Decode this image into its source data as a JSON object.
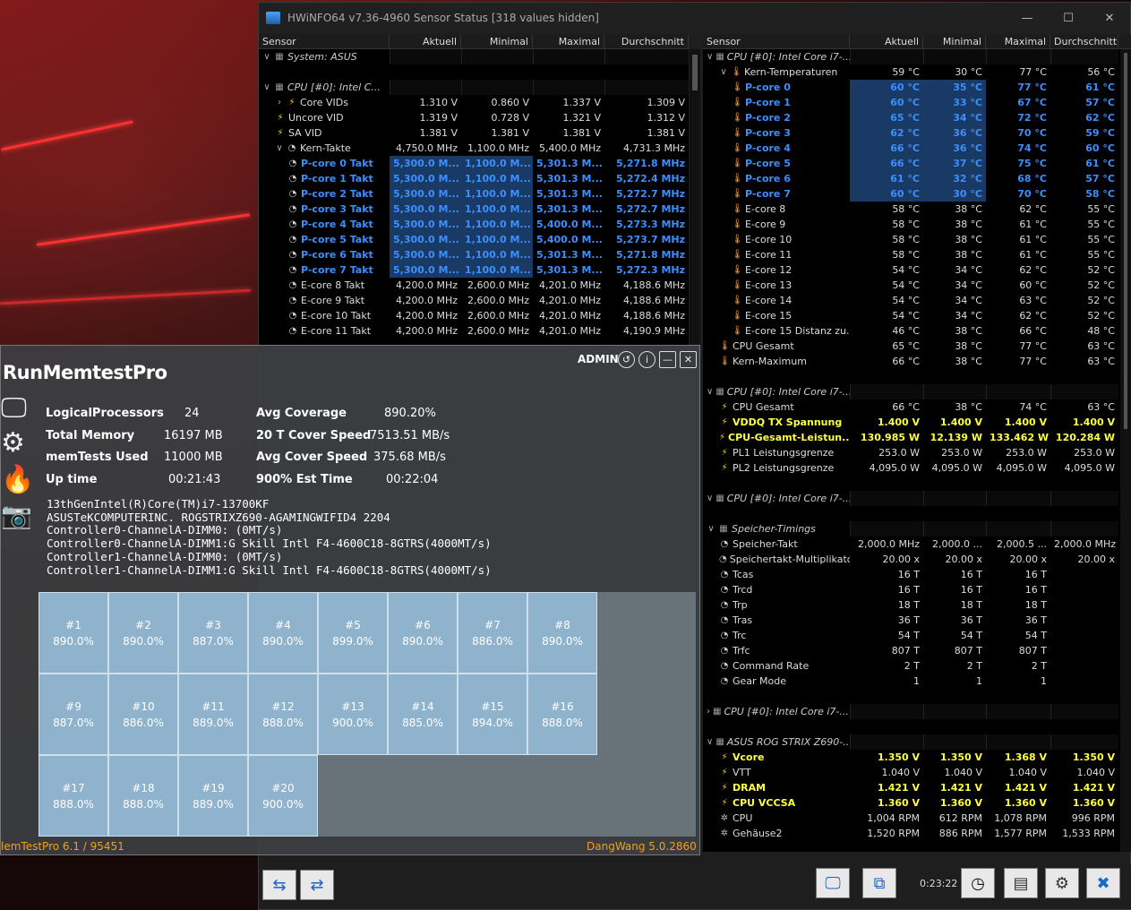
{
  "hwinfo": {
    "title": "HWiNFO64 v7.36-4960 Sensor Status [318 values hidden]",
    "win_controls": {
      "minimize": "—",
      "maximize": "☐",
      "close": "✕"
    },
    "columns": [
      "Sensor",
      "Aktuell",
      "Minimal",
      "Maximal",
      "Durchschnitt"
    ],
    "left_rows": [
      {
        "type": "group",
        "exp": "∨",
        "icon": "chip",
        "label": "System: ASUS",
        "v": [
          "",
          "",
          "",
          ""
        ]
      },
      {
        "type": "spacer"
      },
      {
        "type": "group",
        "exp": "∨",
        "icon": "chip",
        "label": "CPU [#0]: Intel C...",
        "v": [
          "",
          "",
          "",
          ""
        ]
      },
      {
        "type": "row",
        "exp": "›",
        "icon": "bolt",
        "label": "Core VIDs",
        "v": [
          "1.310 V",
          "0.860 V",
          "1.337 V",
          "1.309 V"
        ]
      },
      {
        "type": "row",
        "icon": "bolt",
        "label": "Uncore VID",
        "v": [
          "1.319 V",
          "0.728 V",
          "1.321 V",
          "1.312 V"
        ]
      },
      {
        "type": "row",
        "icon": "bolt",
        "label": "SA VID",
        "v": [
          "1.381 V",
          "1.381 V",
          "1.381 V",
          "1.381 V"
        ]
      },
      {
        "type": "row",
        "exp": "∨",
        "icon": "clock",
        "label": "Kern-Takte",
        "v": [
          "4,750.0 MHz",
          "1,100.0 MHz",
          "5,400.0 MHz",
          "4,731.3 MHz"
        ]
      },
      {
        "type": "blue",
        "icon": "clock",
        "label": "P-core 0 Takt",
        "v": [
          "5,300.0 M...",
          "1,100.0 M...",
          "5,301.3 M...",
          "5,271.8 MHz"
        ]
      },
      {
        "type": "blue",
        "icon": "clock",
        "label": "P-core 1 Takt",
        "v": [
          "5,300.0 M...",
          "1,100.0 M...",
          "5,301.3 M...",
          "5,272.4 MHz"
        ]
      },
      {
        "type": "blue",
        "icon": "clock",
        "label": "P-core 2 Takt",
        "v": [
          "5,300.0 M...",
          "1,100.0 M...",
          "5,301.3 M...",
          "5,272.7 MHz"
        ]
      },
      {
        "type": "blue",
        "icon": "clock",
        "label": "P-core 3 Takt",
        "v": [
          "5,300.0 M...",
          "1,100.0 M...",
          "5,301.3 M...",
          "5,272.7 MHz"
        ]
      },
      {
        "type": "blue",
        "icon": "clock",
        "label": "P-core 4 Takt",
        "v": [
          "5,300.0 M...",
          "1,100.0 M...",
          "5,400.0 M...",
          "5,273.3 MHz"
        ]
      },
      {
        "type": "blue",
        "icon": "clock",
        "label": "P-core 5 Takt",
        "v": [
          "5,300.0 M...",
          "1,100.0 M...",
          "5,400.0 M...",
          "5,273.7 MHz"
        ]
      },
      {
        "type": "blue",
        "icon": "clock",
        "label": "P-core 6 Takt",
        "v": [
          "5,300.0 M...",
          "1,100.0 M...",
          "5,301.3 M...",
          "5,271.8 MHz"
        ]
      },
      {
        "type": "blue",
        "icon": "clock",
        "label": "P-core 7 Takt",
        "v": [
          "5,300.0 M...",
          "1,100.0 M...",
          "5,301.3 M...",
          "5,272.3 MHz"
        ]
      },
      {
        "type": "row",
        "icon": "clock",
        "label": "E-core 8 Takt",
        "v": [
          "4,200.0 MHz",
          "2,600.0 MHz",
          "4,201.0 MHz",
          "4,188.6 MHz"
        ]
      },
      {
        "type": "row",
        "icon": "clock",
        "label": "E-core 9 Takt",
        "v": [
          "4,200.0 MHz",
          "2,600.0 MHz",
          "4,201.0 MHz",
          "4,188.6 MHz"
        ]
      },
      {
        "type": "row",
        "icon": "clock",
        "label": "E-core 10 Takt",
        "v": [
          "4,200.0 MHz",
          "2,600.0 MHz",
          "4,201.0 MHz",
          "4,188.6 MHz"
        ]
      },
      {
        "type": "row",
        "icon": "clock",
        "label": "E-core 11 Takt",
        "v": [
          "4,200.0 MHz",
          "2,600.0 MHz",
          "4,201.0 MHz",
          "4,190.9 MHz"
        ]
      }
    ],
    "right_rows": [
      {
        "type": "group",
        "exp": "∨",
        "icon": "chip",
        "label": "CPU [#0]: Intel Core i7-...",
        "v": [
          "",
          "",
          "",
          ""
        ]
      },
      {
        "type": "row",
        "exp": "∨",
        "icon": "therm",
        "label": "Kern-Temperaturen",
        "v": [
          "59 °C",
          "30 °C",
          "77 °C",
          "56 °C"
        ]
      },
      {
        "type": "blue",
        "icon": "therm",
        "label": "P-core 0",
        "v": [
          "60 °C",
          "35 °C",
          "77 °C",
          "61 °C"
        ]
      },
      {
        "type": "blue",
        "icon": "therm",
        "label": "P-core 1",
        "v": [
          "60 °C",
          "33 °C",
          "67 °C",
          "57 °C"
        ]
      },
      {
        "type": "blue",
        "icon": "therm",
        "label": "P-core 2",
        "v": [
          "65 °C",
          "34 °C",
          "72 °C",
          "62 °C"
        ]
      },
      {
        "type": "blue",
        "icon": "therm",
        "label": "P-core 3",
        "v": [
          "62 °C",
          "36 °C",
          "70 °C",
          "59 °C"
        ]
      },
      {
        "type": "blue",
        "icon": "therm",
        "label": "P-core 4",
        "v": [
          "66 °C",
          "36 °C",
          "74 °C",
          "60 °C"
        ]
      },
      {
        "type": "blue",
        "icon": "therm",
        "label": "P-core 5",
        "v": [
          "66 °C",
          "37 °C",
          "75 °C",
          "61 °C"
        ]
      },
      {
        "type": "blue",
        "icon": "therm",
        "label": "P-core 6",
        "v": [
          "61 °C",
          "32 °C",
          "68 °C",
          "57 °C"
        ]
      },
      {
        "type": "blue",
        "icon": "therm",
        "label": "P-core 7",
        "v": [
          "60 °C",
          "30 °C",
          "70 °C",
          "58 °C"
        ]
      },
      {
        "type": "row",
        "icon": "therm",
        "label": "E-core 8",
        "v": [
          "58 °C",
          "38 °C",
          "62 °C",
          "55 °C"
        ]
      },
      {
        "type": "row",
        "icon": "therm",
        "label": "E-core 9",
        "v": [
          "58 °C",
          "38 °C",
          "61 °C",
          "55 °C"
        ]
      },
      {
        "type": "row",
        "icon": "therm",
        "label": "E-core 10",
        "v": [
          "58 °C",
          "38 °C",
          "61 °C",
          "55 °C"
        ]
      },
      {
        "type": "row",
        "icon": "therm",
        "label": "E-core 11",
        "v": [
          "58 °C",
          "38 °C",
          "61 °C",
          "55 °C"
        ]
      },
      {
        "type": "row",
        "icon": "therm",
        "label": "E-core 12",
        "v": [
          "54 °C",
          "34 °C",
          "62 °C",
          "52 °C"
        ]
      },
      {
        "type": "row",
        "icon": "therm",
        "label": "E-core 13",
        "v": [
          "54 °C",
          "34 °C",
          "60 °C",
          "52 °C"
        ]
      },
      {
        "type": "row",
        "icon": "therm",
        "label": "E-core 14",
        "v": [
          "54 °C",
          "34 °C",
          "63 °C",
          "52 °C"
        ]
      },
      {
        "type": "row",
        "icon": "therm",
        "label": "E-core 15",
        "v": [
          "54 °C",
          "34 °C",
          "62 °C",
          "52 °C"
        ]
      },
      {
        "type": "row",
        "icon": "therm",
        "label": "E-core 15 Distanz zu...",
        "v": [
          "46 °C",
          "38 °C",
          "66 °C",
          "48 °C"
        ]
      },
      {
        "type": "row",
        "icon": "therm",
        "label": "CPU Gesamt",
        "v": [
          "65 °C",
          "38 °C",
          "77 °C",
          "63 °C"
        ]
      },
      {
        "type": "row",
        "icon": "therm",
        "label": "Kern-Maximum",
        "v": [
          "66 °C",
          "38 °C",
          "77 °C",
          "63 °C"
        ]
      },
      {
        "type": "spacer"
      },
      {
        "type": "group",
        "exp": "∨",
        "icon": "chip",
        "label": "CPU [#0]: Intel Core i7-...",
        "v": [
          "",
          "",
          "",
          ""
        ]
      },
      {
        "type": "row",
        "icon": "bolt",
        "label": "CPU Gesamt",
        "v": [
          "66 °C",
          "38 °C",
          "74 °C",
          "63 °C"
        ]
      },
      {
        "type": "yellow",
        "icon": "bolt",
        "label": "VDDQ TX Spannung",
        "v": [
          "1.400 V",
          "1.400 V",
          "1.400 V",
          "1.400 V"
        ]
      },
      {
        "type": "yellow",
        "icon": "bolt",
        "label": "CPU-Gesamt-Leistun...",
        "v": [
          "130.985 W",
          "12.139 W",
          "133.462 W",
          "120.284 W"
        ]
      },
      {
        "type": "row",
        "icon": "bolt",
        "label": "PL1 Leistungsgrenze",
        "v": [
          "253.0 W",
          "253.0 W",
          "253.0 W",
          "253.0 W"
        ]
      },
      {
        "type": "row",
        "icon": "bolt",
        "label": "PL2 Leistungsgrenze",
        "v": [
          "4,095.0 W",
          "4,095.0 W",
          "4,095.0 W",
          "4,095.0 W"
        ]
      },
      {
        "type": "spacer"
      },
      {
        "type": "group",
        "exp": "∨",
        "icon": "chip",
        "label": "CPU [#0]: Intel Core i7-...",
        "v": [
          "",
          "",
          "",
          ""
        ]
      },
      {
        "type": "spacer"
      },
      {
        "type": "group",
        "exp": "∨",
        "icon": "chip",
        "label": "Speicher-Timings",
        "v": [
          "",
          "",
          "",
          ""
        ]
      },
      {
        "type": "row",
        "icon": "clock",
        "label": "Speicher-Takt",
        "v": [
          "2,000.0 MHz",
          "2,000.0 ...",
          "2,000.5 ...",
          "2,000.0 MHz"
        ]
      },
      {
        "type": "row",
        "icon": "clock",
        "label": "Speichertakt-Multiplikator",
        "v": [
          "20.00 x",
          "20.00 x",
          "20.00 x",
          "20.00 x"
        ]
      },
      {
        "type": "row",
        "icon": "clock",
        "label": "Tcas",
        "v": [
          "16 T",
          "16 T",
          "16 T",
          ""
        ]
      },
      {
        "type": "row",
        "icon": "clock",
        "label": "Trcd",
        "v": [
          "16 T",
          "16 T",
          "16 T",
          ""
        ]
      },
      {
        "type": "row",
        "icon": "clock",
        "label": "Trp",
        "v": [
          "18 T",
          "18 T",
          "18 T",
          ""
        ]
      },
      {
        "type": "row",
        "icon": "clock",
        "label": "Tras",
        "v": [
          "36 T",
          "36 T",
          "36 T",
          ""
        ]
      },
      {
        "type": "row",
        "icon": "clock",
        "label": "Trc",
        "v": [
          "54 T",
          "54 T",
          "54 T",
          ""
        ]
      },
      {
        "type": "row",
        "icon": "clock",
        "label": "Trfc",
        "v": [
          "807 T",
          "807 T",
          "807 T",
          ""
        ]
      },
      {
        "type": "row",
        "icon": "clock",
        "label": "Command Rate",
        "v": [
          "2 T",
          "2 T",
          "2 T",
          ""
        ]
      },
      {
        "type": "row",
        "icon": "clock",
        "label": "Gear Mode",
        "v": [
          "1",
          "1",
          "1",
          ""
        ]
      },
      {
        "type": "spacer"
      },
      {
        "type": "group",
        "exp": "›",
        "icon": "chip",
        "label": "CPU [#0]: Intel Core i7-...",
        "v": [
          "",
          "",
          "",
          ""
        ]
      },
      {
        "type": "spacer"
      },
      {
        "type": "group",
        "exp": "∨",
        "icon": "chip",
        "label": "ASUS ROG STRIX Z690-...",
        "v": [
          "",
          "",
          "",
          ""
        ]
      },
      {
        "type": "yellow",
        "icon": "bolt",
        "label": "Vcore",
        "v": [
          "1.350 V",
          "1.350 V",
          "1.368 V",
          "1.350 V"
        ]
      },
      {
        "type": "row",
        "icon": "bolt",
        "label": "VTT",
        "v": [
          "1.040 V",
          "1.040 V",
          "1.040 V",
          "1.040 V"
        ]
      },
      {
        "type": "yellow",
        "icon": "bolt",
        "label": "DRAM",
        "v": [
          "1.421 V",
          "1.421 V",
          "1.421 V",
          "1.421 V"
        ]
      },
      {
        "type": "yellow",
        "icon": "bolt",
        "label": "CPU VCCSA",
        "v": [
          "1.360 V",
          "1.360 V",
          "1.360 V",
          "1.360 V"
        ]
      },
      {
        "type": "row",
        "icon": "fan",
        "label": "CPU",
        "v": [
          "1,004 RPM",
          "612 RPM",
          "1,078 RPM",
          "996 RPM"
        ]
      },
      {
        "type": "row",
        "icon": "fan",
        "label": "Gehäuse2",
        "v": [
          "1,520 RPM",
          "886 RPM",
          "1,577 RPM",
          "1,533 RPM"
        ]
      }
    ],
    "timer": "0:23:22"
  },
  "memtest": {
    "title": "RunMemtestPro",
    "admin": "ADMIN",
    "stats": [
      {
        "label": "LogicalProcessors",
        "value": "24"
      },
      {
        "label": "Total Memory",
        "value": "16197 MB"
      },
      {
        "label": "memTests Used",
        "value": "11000 MB"
      },
      {
        "label": "Up time",
        "value": "00:21:43"
      },
      {
        "label": "Avg Coverage",
        "value": "890.20%"
      },
      {
        "label": "20 T Cover Speed",
        "value": "7513.51 MB/s"
      },
      {
        "label": "Avg Cover Speed",
        "value": "375.68 MB/s"
      },
      {
        "label": "900% Est Time",
        "value": "00:22:04"
      }
    ],
    "sysinfo": [
      "13thGenIntel(R)Core(TM)i7-13700KF",
      "ASUSTeKCOMPUTERINC. ROGSTRIXZ690-AGAMINGWIFID4 2204",
      "Controller0-ChannelA-DIMM0: (0MT/s)",
      "Controller0-ChannelA-DIMM1:G Skill Intl F4-4600C18-8GTRS(4000MT/s)",
      "Controller1-ChannelA-DIMM0: (0MT/s)",
      "Controller1-ChannelA-DIMM1:G Skill Intl F4-4600C18-8GTRS(4000MT/s)"
    ],
    "threads": [
      {
        "id": "#1",
        "cov": "890.0%"
      },
      {
        "id": "#2",
        "cov": "890.0%"
      },
      {
        "id": "#3",
        "cov": "887.0%"
      },
      {
        "id": "#4",
        "cov": "890.0%"
      },
      {
        "id": "#5",
        "cov": "899.0%"
      },
      {
        "id": "#6",
        "cov": "890.0%"
      },
      {
        "id": "#7",
        "cov": "886.0%"
      },
      {
        "id": "#8",
        "cov": "890.0%"
      },
      {
        "id": "#9",
        "cov": "887.0%"
      },
      {
        "id": "#10",
        "cov": "886.0%"
      },
      {
        "id": "#11",
        "cov": "889.0%"
      },
      {
        "id": "#12",
        "cov": "888.0%"
      },
      {
        "id": "#13",
        "cov": "900.0%"
      },
      {
        "id": "#14",
        "cov": "885.0%"
      },
      {
        "id": "#15",
        "cov": "894.0%"
      },
      {
        "id": "#16",
        "cov": "888.0%"
      },
      {
        "id": "#17",
        "cov": "888.0%"
      },
      {
        "id": "#18",
        "cov": "888.0%"
      },
      {
        "id": "#19",
        "cov": "889.0%"
      },
      {
        "id": "#20",
        "cov": "900.0%"
      }
    ],
    "footer_left": "lemTestPro 6.1 / 95451",
    "footer_right": "DangWang 5.0.2860"
  }
}
